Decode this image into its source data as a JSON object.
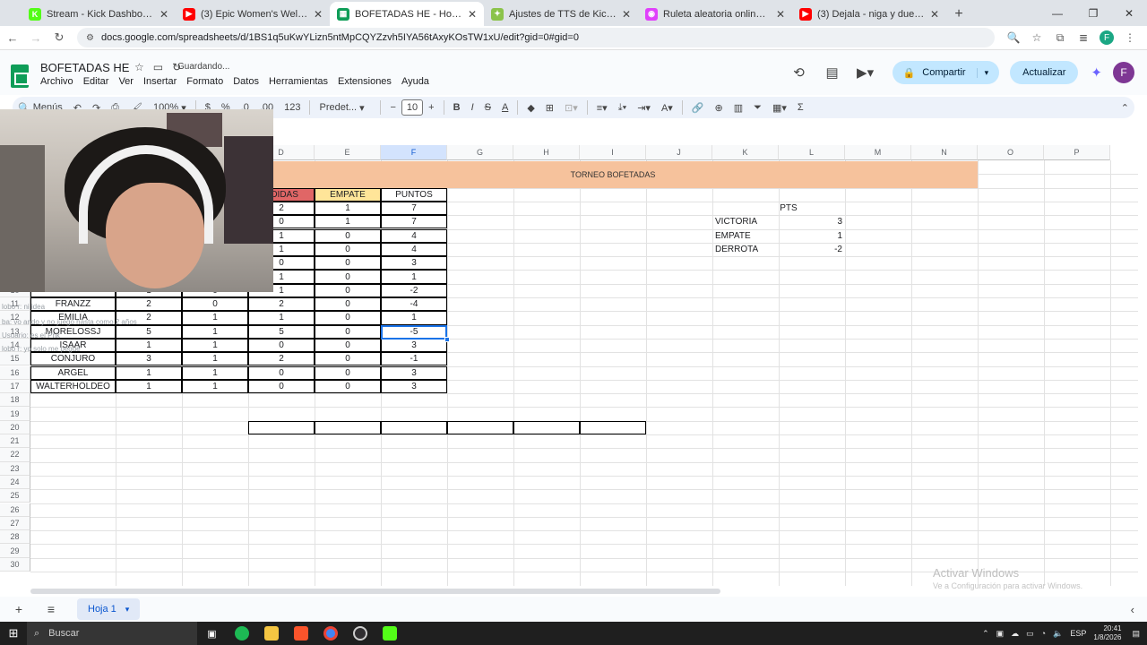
{
  "browser": {
    "tabs": [
      {
        "label": "Stream - Kick Dashboard",
        "color": "#53fc18",
        "glyph": "K",
        "active": false
      },
      {
        "label": "(3) Epic Women's Welterweight",
        "color": "#ff0000",
        "glyph": "▶",
        "active": false
      },
      {
        "label": "BOFETADAS HE - Hojas de cálculo",
        "color": "#0f9d58",
        "glyph": "▦",
        "active": true
      },
      {
        "label": "Ajustes de TTS de KickBot",
        "color": "#8bc34a",
        "glyph": "✦",
        "active": false
      },
      {
        "label": "Ruleta aleatoria online – ruleta",
        "color": "#e040fb",
        "glyph": "◉",
        "active": false
      },
      {
        "label": "(3) Dejala - niga y duende - You",
        "color": "#ff0000",
        "glyph": "▶",
        "active": false
      }
    ],
    "url": "docs.google.com/spreadsheets/d/1BS1q5uKwYLizn5ntMpCQYZzvh5IYA56tAxyKOsTW1xU/edit?gid=0#gid=0",
    "profile_initial": "F"
  },
  "sheet": {
    "title": "BOFETADAS HE",
    "save_status": "Guardando...",
    "menu": [
      "Archivo",
      "Editar",
      "Ver",
      "Insertar",
      "Formato",
      "Datos",
      "Herramientas",
      "Extensiones",
      "Ayuda"
    ],
    "share_label": "Compartir",
    "update_label": "Actualizar",
    "avatar_initial": "F",
    "toolbar": {
      "search": "Menús",
      "zoom": "100%",
      "currency": "$",
      "percent": "%",
      "dec_less": ".0",
      "dec_more": ".00",
      "num_format": "123",
      "font": "Predet...",
      "font_size": "10"
    },
    "columns": [
      "D",
      "E",
      "F",
      "G",
      "H",
      "I",
      "J",
      "K",
      "L",
      "M",
      "N",
      "O",
      "P"
    ],
    "selected_column": "F",
    "row_numbers": [
      "1",
      "2",
      "3",
      "4",
      "5",
      "6",
      "7",
      "8",
      "9",
      "10",
      "11",
      "12",
      "13",
      "14",
      "15",
      "16",
      "17",
      "18",
      "19",
      "20",
      "21",
      "22",
      "23",
      "24",
      "25",
      "26",
      "27",
      "28",
      "29",
      "30"
    ],
    "banner_title": "TORNEO BOFETADAS",
    "headers": {
      "d": "RDIDAS",
      "e": "EMPATE",
      "f": "PUNTOS"
    },
    "header_colors": {
      "d": "#e06666",
      "e": "#ffe599",
      "f": "#ffffff",
      "banner": "#f6c29c"
    },
    "rows": [
      {
        "name": "",
        "b": "",
        "c": "",
        "d": "2",
        "e": "1",
        "f": "7"
      },
      {
        "name": "",
        "b": "",
        "c": "",
        "d": "0",
        "e": "1",
        "f": "7"
      },
      {
        "name": "",
        "b": "",
        "c": "",
        "d": "1",
        "e": "0",
        "f": "4"
      },
      {
        "name": "",
        "b": "",
        "c": "",
        "d": "1",
        "e": "0",
        "f": "4"
      },
      {
        "name": "",
        "b": "",
        "c": "",
        "d": "0",
        "e": "0",
        "f": "3"
      },
      {
        "name": "",
        "b": "",
        "c": "",
        "d": "1",
        "e": "0",
        "f": "1"
      },
      {
        "name": "",
        "b": "1",
        "c": "0",
        "d": "1",
        "e": "0",
        "f": "-2"
      },
      {
        "name": "FRANZZ",
        "b": "2",
        "c": "0",
        "d": "2",
        "e": "0",
        "f": "-4"
      },
      {
        "name": "EMILIA",
        "b": "2",
        "c": "1",
        "d": "1",
        "e": "0",
        "f": "1"
      },
      {
        "name": "MORELOSSJ",
        "b": "5",
        "c": "1",
        "d": "5",
        "e": "0",
        "f": "-5"
      },
      {
        "name": "ISAAR",
        "b": "1",
        "c": "1",
        "d": "0",
        "e": "0",
        "f": "3"
      },
      {
        "name": "CONJURO",
        "b": "3",
        "c": "1",
        "d": "2",
        "e": "0",
        "f": "-1"
      },
      {
        "name": "ARGEL",
        "b": "1",
        "c": "1",
        "d": "0",
        "e": "0",
        "f": "3"
      },
      {
        "name": "WALTERHOLDEO",
        "b": "1",
        "c": "1",
        "d": "0",
        "e": "0",
        "f": "3"
      }
    ],
    "pts_table": {
      "header": "PTS",
      "rows": [
        {
          "label": "VICTORIA",
          "value": "3"
        },
        {
          "label": "EMPATE",
          "value": "1"
        },
        {
          "label": "DERROTA",
          "value": "-2"
        }
      ]
    },
    "sheet_tab": "Hoja 1",
    "watermark_title": "Activar Windows",
    "watermark_sub": "Ve a Configuración para activar Windows."
  },
  "chat_overlay": [
    "lobo r: ni idea",
    "ba: vo ando y no juego hasta como 2 años",
    "Usuario: es el Prik",
    "lobo r: yo solo me pegue"
  ],
  "taskbar": {
    "search_placeholder": "Buscar",
    "lang": "ESP",
    "time": "20:41",
    "date": "1/8/2026"
  }
}
